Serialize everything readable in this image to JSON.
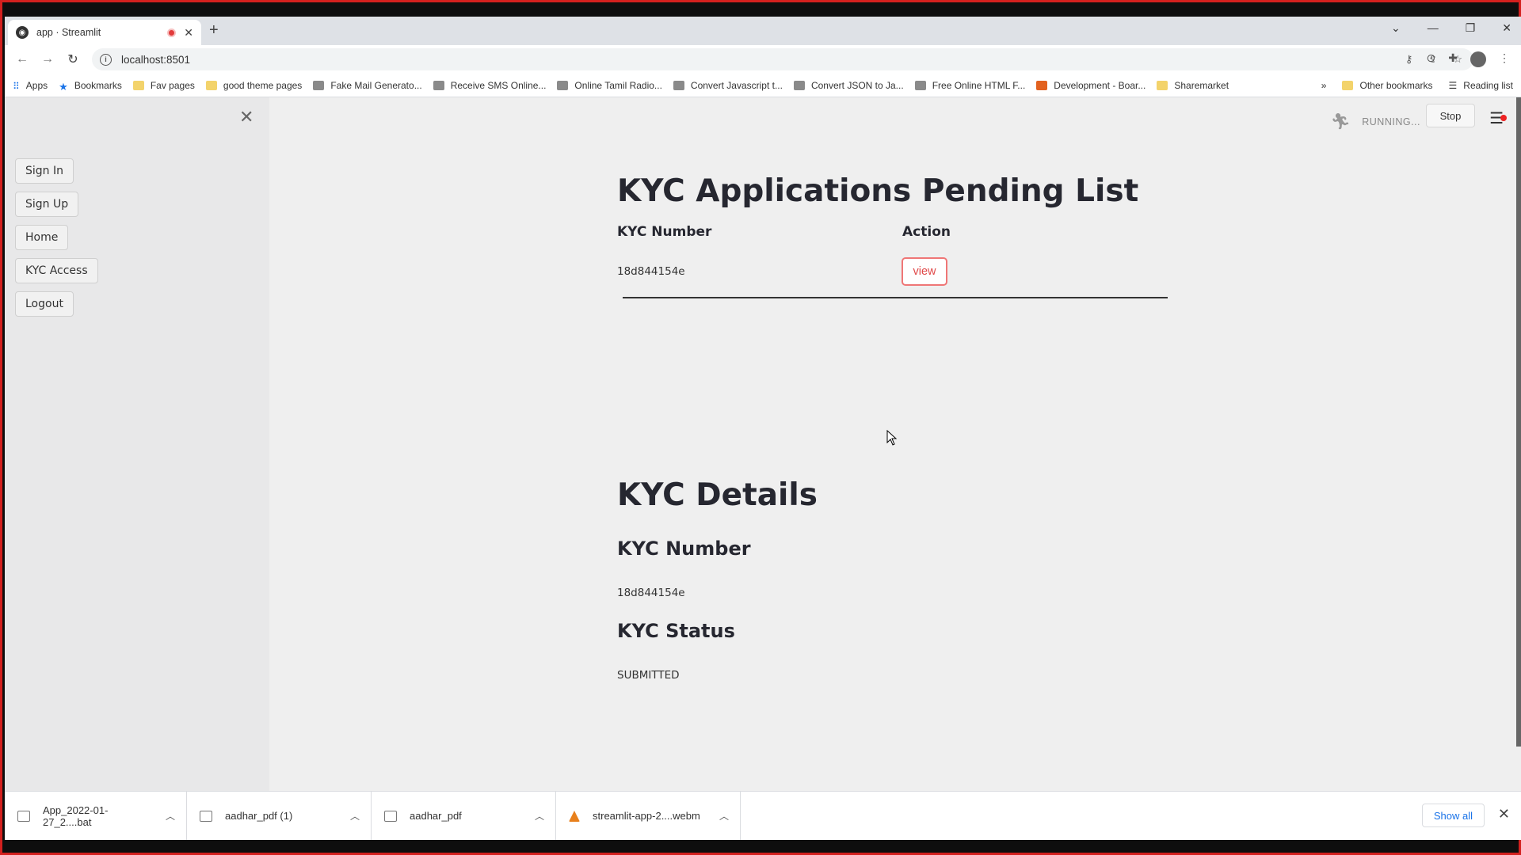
{
  "browser": {
    "tab_title": "app · Streamlit",
    "url": "localhost:8501",
    "bookmarks": [
      "Apps",
      "Bookmarks",
      "Fav pages",
      "good theme pages",
      "Fake Mail Generato...",
      "Receive SMS Online...",
      "Online Tamil Radio...",
      "Convert Javascript t...",
      "Convert JSON to Ja...",
      "Free Online HTML F...",
      "Development - Boar...",
      "Sharemarket"
    ],
    "bookmarks_overflow": "»",
    "other_bookmarks": "Other bookmarks",
    "reading_list": "Reading list"
  },
  "status": {
    "running": "RUNNING...",
    "stop": "Stop"
  },
  "sidebar": {
    "buttons": [
      "Sign In",
      "Sign Up",
      "Home",
      "KYC Access",
      "Logout"
    ]
  },
  "pending": {
    "title": "KYC Applications Pending List",
    "col_kyc": "KYC Number",
    "col_action": "Action",
    "row_kyc": "18d844154e",
    "row_action": "view"
  },
  "details": {
    "title": "KYC Details",
    "kyc_number_label": "KYC Number",
    "kyc_number_value": "18d844154e",
    "status_label": "KYC Status",
    "status_value": "SUBMITTED"
  },
  "downloads": {
    "items": [
      "App_2022-01-27_2....bat",
      "aadhar_pdf (1)",
      "aadhar_pdf",
      "streamlit-app-2....webm"
    ],
    "show_all": "Show all"
  }
}
